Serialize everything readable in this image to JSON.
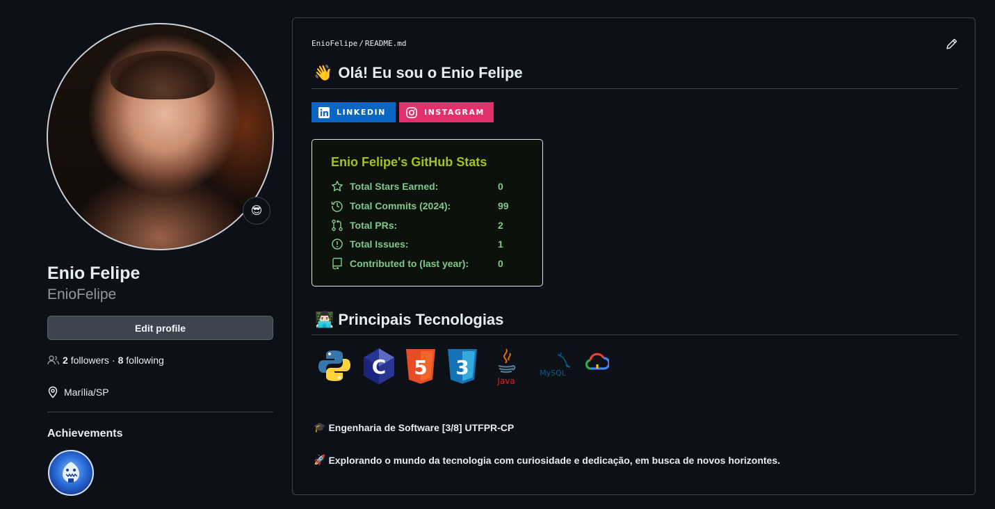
{
  "profile": {
    "full_name": "Enio Felipe",
    "username": "EnioFelipe",
    "status_emoji": "😎",
    "edit_button": "Edit profile",
    "followers_count": "2",
    "followers_label": "followers",
    "separator": "·",
    "following_count": "8",
    "following_label": "following",
    "location": "Marília/SP",
    "achievements_title": "Achievements"
  },
  "readme": {
    "owner": "EnioFelipe",
    "slash": "/",
    "file": "README.md",
    "greeting_emoji": "👋",
    "title": "Olá! Eu sou o Enio Felipe",
    "badges": {
      "linkedin": "LINKEDIN",
      "instagram": "INSTAGRAM"
    },
    "stats": {
      "title": "Enio Felipe's GitHub Stats",
      "rows": [
        {
          "label": "Total Stars Earned:",
          "value": "0",
          "icon": "star-icon"
        },
        {
          "label": "Total Commits (2024):",
          "value": "99",
          "icon": "history-icon"
        },
        {
          "label": "Total PRs:",
          "value": "2",
          "icon": "pull-request-icon"
        },
        {
          "label": "Total Issues:",
          "value": "1",
          "icon": "issue-icon"
        },
        {
          "label": "Contributed to (last year):",
          "value": "0",
          "icon": "repo-icon"
        }
      ]
    },
    "tech_emoji": "👨🏻‍💻",
    "tech_title": "Principais Tecnologias",
    "tech": {
      "python": "python-logo",
      "c": "C",
      "html": "5",
      "css": "3",
      "java": "Java",
      "mysql": "MySQL",
      "gcp": "google-cloud-logo"
    },
    "line1_emoji": "🎓",
    "line1": "Engenharia de Software [3/8] UTFPR-CP",
    "line2_emoji": "🚀",
    "line2": "Explorando o mundo da tecnologia com curiosidade e dedicação, em busca de novos horizontes."
  },
  "colors": {
    "background": "#0d1117",
    "stats_title": "#a3c417",
    "stats_text": "#7fc98a",
    "linkedin": "#0a66c2",
    "instagram": "#e1306c"
  }
}
